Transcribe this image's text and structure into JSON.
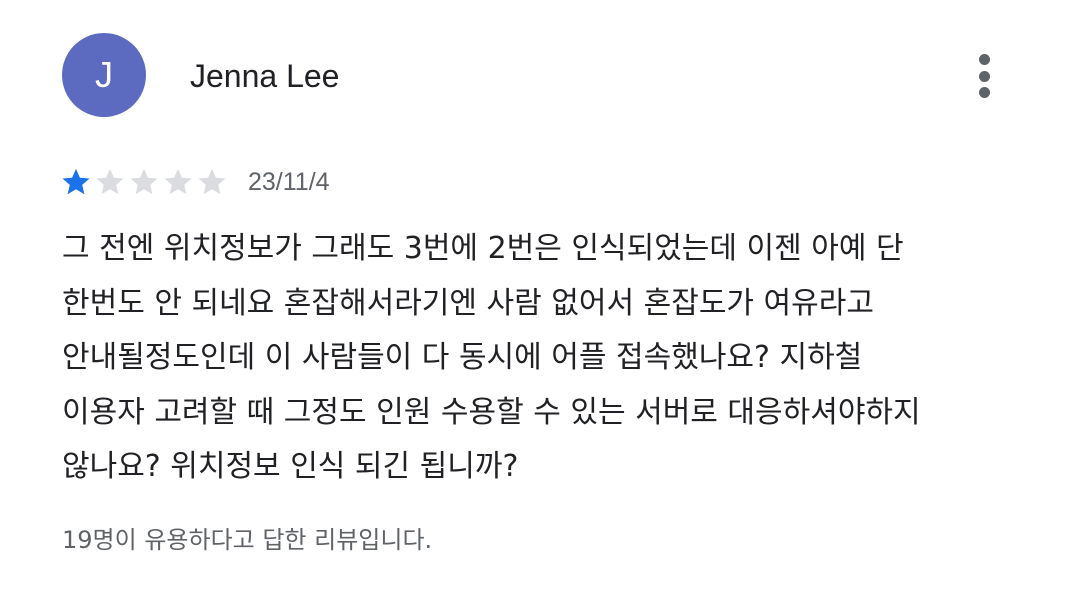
{
  "review": {
    "author": {
      "initial": "J",
      "name": "Jenna Lee",
      "avatar_color": "#5c6bc0"
    },
    "more_options_icon": "more-vert-icon",
    "rating": 1,
    "rating_max": 5,
    "star_colors": {
      "filled": "#1a73e8",
      "empty": "#dadce0"
    },
    "date": "23/11/4",
    "text": "그 전엔 위치정보가 그래도 3번에 2번은 인식되었는데 이젠 아예 단\n한번도 안 되네요 혼잡해서라기엔 사람 없어서 혼잡도가 여유라고\n안내될정도인데 이 사람들이 다 동시에 어플 접속했나요? 지하철\n이용자 고려할 때 그정도 인원 수용할 수 있는 서버로 대응하셔야하지\n않나요? 위치정보 인식 되긴 됩니까?",
    "helpful_text": "19명이 유용하다고 답한 리뷰입니다."
  }
}
